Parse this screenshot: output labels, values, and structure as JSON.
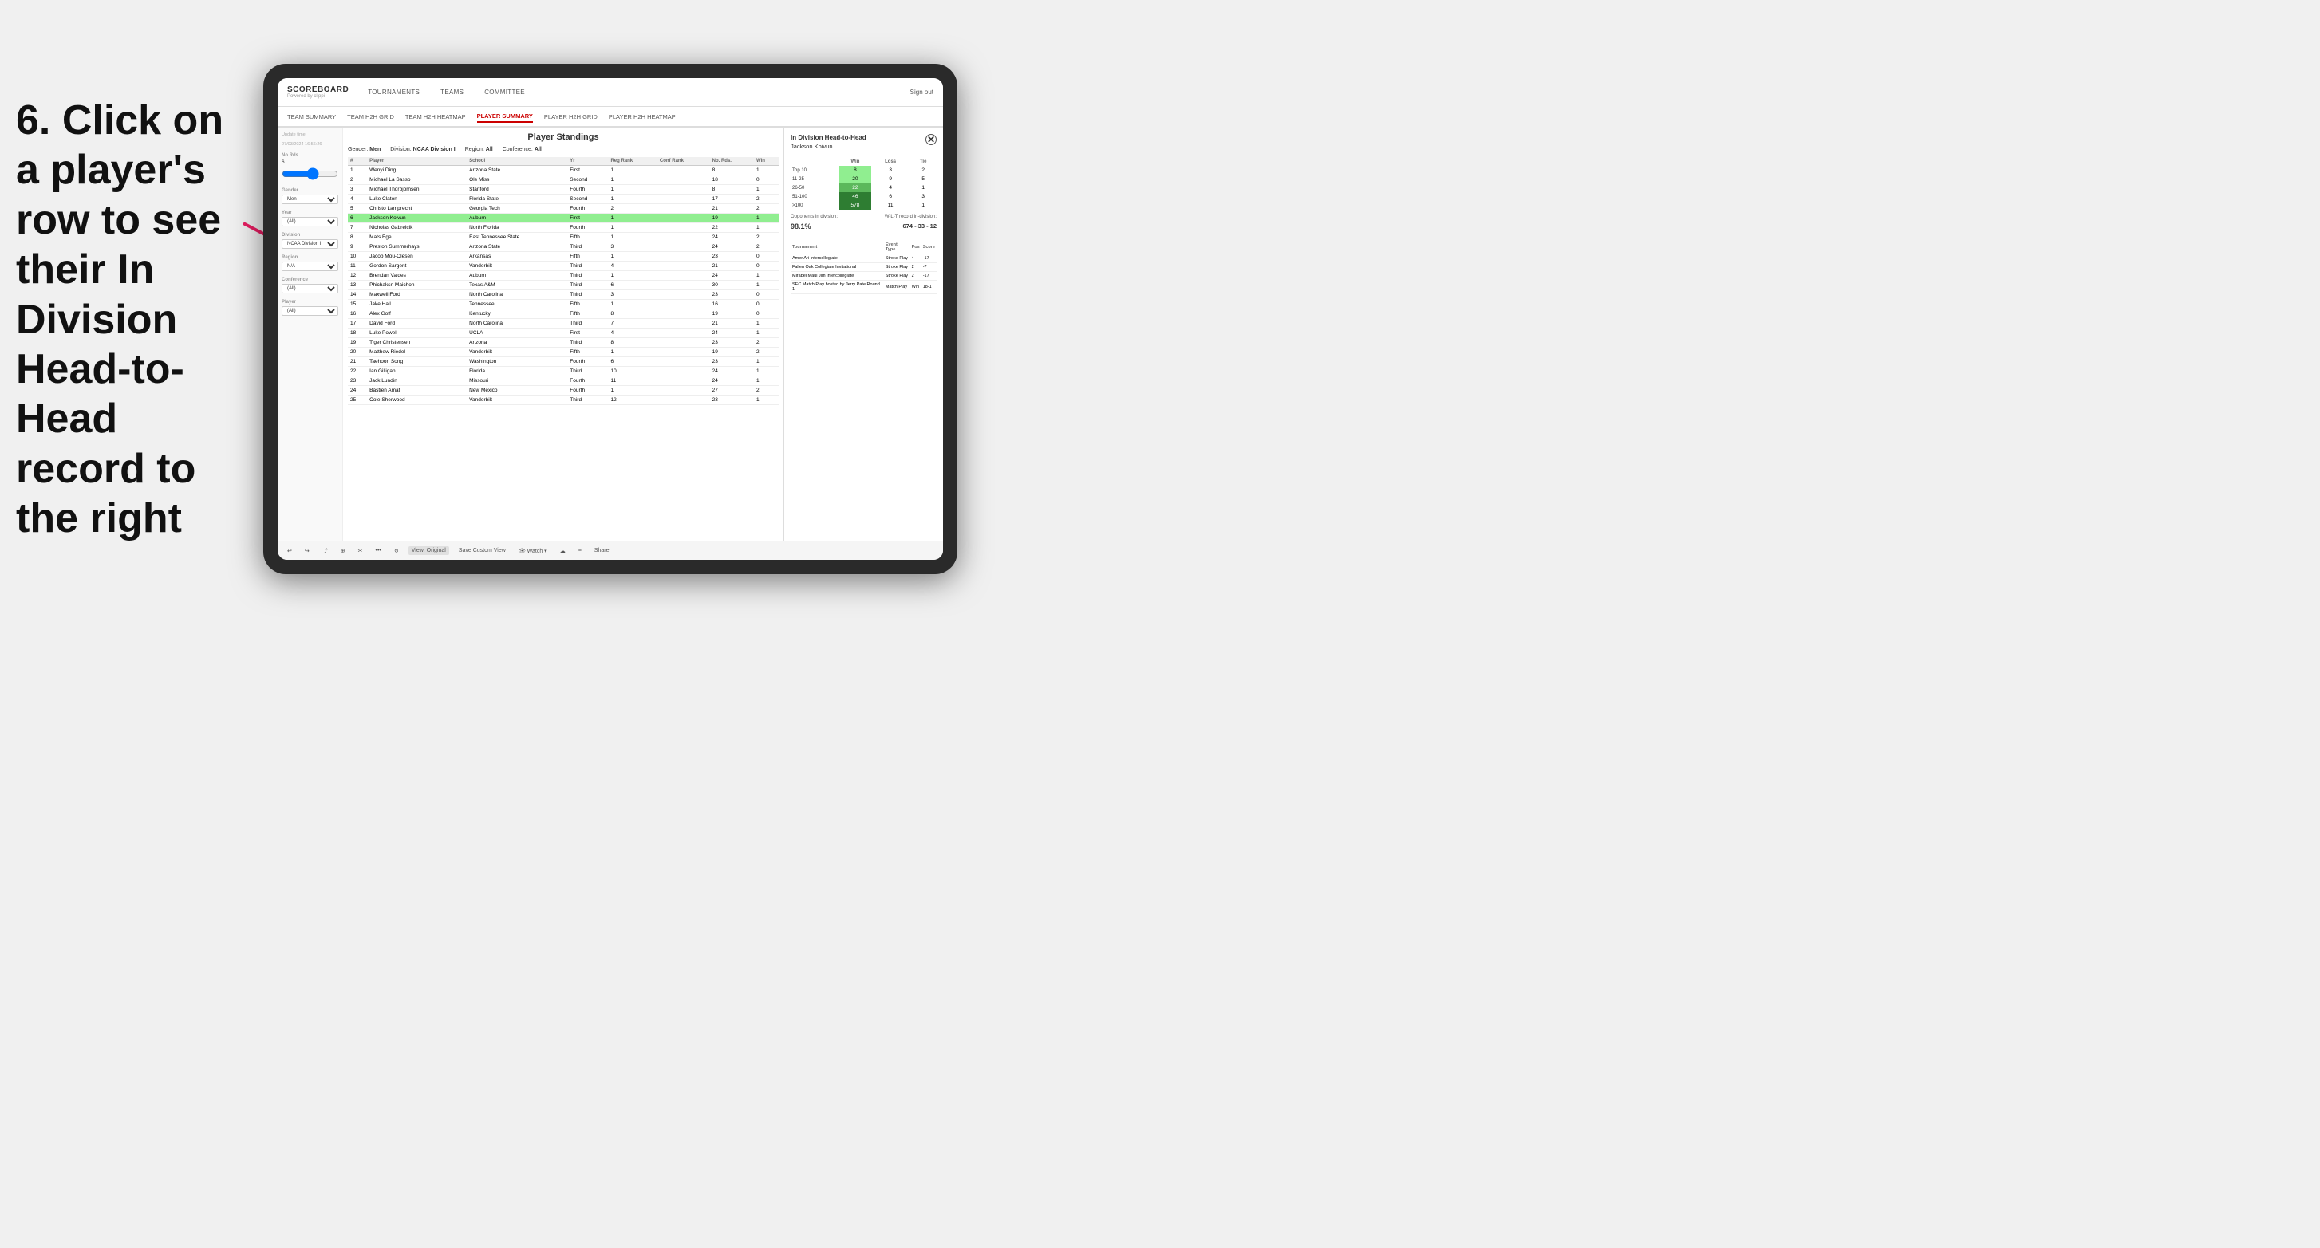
{
  "instruction": {
    "text": "6. Click on a player's row to see their In Division Head-to-Head record to the right"
  },
  "nav": {
    "logo": "SCOREBOARD",
    "logo_sub": "Powered by clippi",
    "items": [
      "TOURNAMENTS",
      "TEAMS",
      "COMMITTEE"
    ],
    "sign_out": "Sign out"
  },
  "sub_nav": {
    "items": [
      "TEAM SUMMARY",
      "TEAM H2H GRID",
      "TEAM H2H HEATMAP",
      "PLAYER SUMMARY",
      "PLAYER H2H GRID",
      "PLAYER H2H HEATMAP"
    ],
    "active": "PLAYER SUMMARY"
  },
  "sidebar": {
    "update_label": "Update time:",
    "update_time": "27/03/2024 16:56:26",
    "no_rds_label": "No Rds.",
    "no_rds_value": "6",
    "gender_label": "Gender",
    "gender_value": "Men",
    "year_label": "Year",
    "year_value": "(All)",
    "division_label": "Division",
    "division_value": "NCAA Division I",
    "region_label": "Region",
    "region_value": "N/A",
    "conference_label": "Conference",
    "conference_value": "(All)",
    "player_label": "Player",
    "player_value": "(All)"
  },
  "panel": {
    "title": "Player Standings",
    "gender": "Men",
    "division": "NCAA Division I",
    "region": "All",
    "conference": "All"
  },
  "table": {
    "headers": [
      "#",
      "Player",
      "School",
      "Yr",
      "Reg Rank",
      "Conf Rank",
      "No. Rds.",
      "Win"
    ],
    "rows": [
      {
        "num": 1,
        "player": "Wenyi Ding",
        "school": "Arizona State",
        "yr": "First",
        "reg": 1,
        "conf": "",
        "rds": 8,
        "win": 1
      },
      {
        "num": 2,
        "player": "Michael La Sasso",
        "school": "Ole Miss",
        "yr": "Second",
        "reg": 1,
        "conf": "",
        "rds": 18,
        "win": 0
      },
      {
        "num": 3,
        "player": "Michael Thorbjornsen",
        "school": "Stanford",
        "yr": "Fourth",
        "reg": 1,
        "conf": "",
        "rds": 8,
        "win": 1
      },
      {
        "num": 4,
        "player": "Luke Claton",
        "school": "Florida State",
        "yr": "Second",
        "reg": 1,
        "conf": "",
        "rds": 17,
        "win": 2
      },
      {
        "num": 5,
        "player": "Christo Lamprecht",
        "school": "Georgia Tech",
        "yr": "Fourth",
        "reg": 2,
        "conf": "",
        "rds": 21,
        "win": 2
      },
      {
        "num": 6,
        "player": "Jackson Koivun",
        "school": "Auburn",
        "yr": "First",
        "reg": 1,
        "conf": "",
        "rds": 19,
        "win": 1,
        "selected": true
      },
      {
        "num": 7,
        "player": "Nicholas Gabrelcik",
        "school": "North Florida",
        "yr": "Fourth",
        "reg": 1,
        "conf": "",
        "rds": 22,
        "win": 1
      },
      {
        "num": 8,
        "player": "Mats Ege",
        "school": "East Tennessee State",
        "yr": "Fifth",
        "reg": 1,
        "conf": "",
        "rds": 24,
        "win": 2
      },
      {
        "num": 9,
        "player": "Preston Summerhays",
        "school": "Arizona State",
        "yr": "Third",
        "reg": 3,
        "conf": "",
        "rds": 24,
        "win": 2
      },
      {
        "num": 10,
        "player": "Jacob Mou-Olesen",
        "school": "Arkansas",
        "yr": "Fifth",
        "reg": 1,
        "conf": "",
        "rds": 23,
        "win": 0
      },
      {
        "num": 11,
        "player": "Gordon Sargent",
        "school": "Vanderbilt",
        "yr": "Third",
        "reg": 4,
        "conf": "",
        "rds": 21,
        "win": 0
      },
      {
        "num": 12,
        "player": "Brendan Valdes",
        "school": "Auburn",
        "yr": "Third",
        "reg": 1,
        "conf": "",
        "rds": 24,
        "win": 1
      },
      {
        "num": 13,
        "player": "Phichaksn Maichon",
        "school": "Texas A&M",
        "yr": "Third",
        "reg": 6,
        "conf": "",
        "rds": 30,
        "win": 1
      },
      {
        "num": 14,
        "player": "Maxwell Ford",
        "school": "North Carolina",
        "yr": "Third",
        "reg": 3,
        "conf": "",
        "rds": 23,
        "win": 0
      },
      {
        "num": 15,
        "player": "Jake Hall",
        "school": "Tennessee",
        "yr": "Fifth",
        "reg": 1,
        "conf": "",
        "rds": 16,
        "win": 0
      },
      {
        "num": 16,
        "player": "Alex Goff",
        "school": "Kentucky",
        "yr": "Fifth",
        "reg": 8,
        "conf": "",
        "rds": 19,
        "win": 0
      },
      {
        "num": 17,
        "player": "David Ford",
        "school": "North Carolina",
        "yr": "Third",
        "reg": 7,
        "conf": "",
        "rds": 21,
        "win": 1
      },
      {
        "num": 18,
        "player": "Luke Powell",
        "school": "UCLA",
        "yr": "First",
        "reg": 4,
        "conf": "",
        "rds": 24,
        "win": 1
      },
      {
        "num": 19,
        "player": "Tiger Christensen",
        "school": "Arizona",
        "yr": "Third",
        "reg": 8,
        "conf": "",
        "rds": 23,
        "win": 2
      },
      {
        "num": 20,
        "player": "Matthew Riedel",
        "school": "Vanderbilt",
        "yr": "Fifth",
        "reg": 1,
        "conf": "",
        "rds": 19,
        "win": 2
      },
      {
        "num": 21,
        "player": "Taehoon Song",
        "school": "Washington",
        "yr": "Fourth",
        "reg": 6,
        "conf": "",
        "rds": 23,
        "win": 1
      },
      {
        "num": 22,
        "player": "Ian Gilligan",
        "school": "Florida",
        "yr": "Third",
        "reg": 10,
        "conf": "",
        "rds": 24,
        "win": 1
      },
      {
        "num": 23,
        "player": "Jack Lundin",
        "school": "Missouri",
        "yr": "Fourth",
        "reg": 11,
        "conf": "",
        "rds": 24,
        "win": 1
      },
      {
        "num": 24,
        "player": "Bastien Amat",
        "school": "New Mexico",
        "yr": "Fourth",
        "reg": 1,
        "conf": "",
        "rds": 27,
        "win": 2
      },
      {
        "num": 25,
        "player": "Cole Sherwood",
        "school": "Vanderbilt",
        "yr": "Third",
        "reg": 12,
        "conf": "",
        "rds": 23,
        "win": 1
      }
    ]
  },
  "h2h": {
    "title": "In Division Head-to-Head",
    "player": "Jackson Koivun",
    "table_headers": [
      "",
      "Win",
      "Loss",
      "Tie"
    ],
    "rows": [
      {
        "label": "Top 10",
        "win": 8,
        "loss": 3,
        "tie": 2
      },
      {
        "label": "11-25",
        "win": 20,
        "loss": 9,
        "tie": 5
      },
      {
        "label": "26-50",
        "win": 22,
        "loss": 4,
        "tie": 1
      },
      {
        "label": "51-100",
        "win": 46,
        "loss": 6,
        "tie": 3
      },
      {
        "label": ">100",
        "win": 578,
        "loss": 11,
        "tie": 1
      }
    ],
    "opponents_label": "Opponents in division:",
    "wlt_label": "W-L-T record in-division:",
    "opponents_pct": "98.1%",
    "wlt_record": "674 - 33 - 12",
    "tournament_headers": [
      "Tournament",
      "Event Type",
      "Pos",
      "Score"
    ],
    "tournaments": [
      {
        "name": "Amer Ari Intercollegiate",
        "type": "Stroke Play",
        "pos": 4,
        "score": -17
      },
      {
        "name": "Fallen Oak Collegiate Invitational",
        "type": "Stroke Play",
        "pos": 2,
        "score": -7
      },
      {
        "name": "Mirabel Maui Jim Intercollegiate",
        "type": "Stroke Play",
        "pos": 2,
        "score": -17
      },
      {
        "name": "SEC Match Play hosted by Jerry Pate Round 1",
        "type": "Match Play",
        "pos": "Win",
        "score": "18-1"
      }
    ]
  },
  "toolbar": {
    "buttons": [
      "↩",
      "↪",
      "⤴",
      "⊕",
      "✂",
      "⬤",
      "↻",
      "View: Original",
      "Save Custom View",
      "👁 Watch ▾",
      "☁",
      "≡",
      "Share"
    ]
  }
}
